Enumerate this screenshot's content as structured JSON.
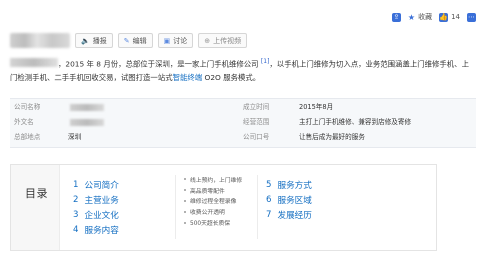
{
  "toolbar": {
    "share_label": "",
    "collect_label": "收藏",
    "like_count": "14",
    "more_label": ""
  },
  "title_actions": [
    {
      "label": "播报",
      "icon": "broadcast-icon"
    },
    {
      "label": "编辑",
      "icon": "pencil-icon"
    },
    {
      "label": "讨论",
      "icon": "comment-icon"
    },
    {
      "label": "上传视频",
      "icon": "plus-circle-icon"
    }
  ],
  "summary": {
    "part1": "，2015 年 8 月份，总部位于深圳，是一家上门手机维修公司",
    "ref": "[1]",
    "part2": "，以手机上门维修为切入点，业务范围涵盖上门维修手机、上门检测手机、二手手机回收交易，试图打造一站式",
    "link": "智能终端",
    "part3": " O2O 服务模式。"
  },
  "info": {
    "rows": [
      {
        "left_label": "公司名称",
        "left_value": "",
        "right_label": "成立时间",
        "right_value": "2015年8月"
      },
      {
        "left_label": "外文名",
        "left_value": "",
        "right_label": "经营范围",
        "right_value": "主打上门手机维修、兼容到店修及寄修"
      },
      {
        "left_label": "总部地点",
        "left_value": "深圳",
        "right_label": "公司口号",
        "right_value": "让售后成为最好的服务"
      }
    ]
  },
  "catalog": {
    "title": "目录",
    "col1": [
      {
        "num": "1",
        "label": "公司简介"
      },
      {
        "num": "2",
        "label": "主营业务"
      },
      {
        "num": "3",
        "label": "企业文化"
      },
      {
        "num": "4",
        "label": "服务内容"
      }
    ],
    "col2": [
      {
        "label": "线上预约，上门维修"
      },
      {
        "label": "高品质零配件"
      },
      {
        "label": "维修过程全程录像"
      },
      {
        "label": "收费公开透明"
      },
      {
        "label": "500天超长质保"
      }
    ],
    "col3": [
      {
        "num": "5",
        "label": "服务方式"
      },
      {
        "num": "6",
        "label": "服务区域"
      },
      {
        "num": "7",
        "label": "发展经历"
      }
    ]
  }
}
